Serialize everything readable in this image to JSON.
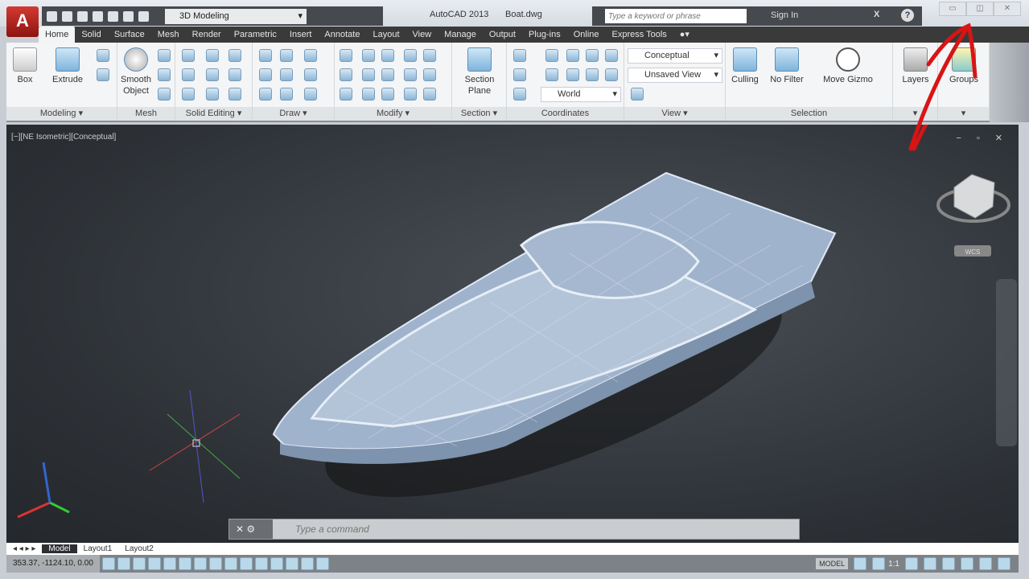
{
  "app": {
    "title": "AutoCAD 2013",
    "file": "Boat.dwg",
    "logo": "A"
  },
  "quick_access": {
    "workspace": "3D Modeling"
  },
  "search": {
    "placeholder": "Type a keyword or phrase",
    "sign_in": "Sign In"
  },
  "window_buttons": [
    "minimize-icon",
    "restore-icon",
    "close-icon"
  ],
  "tabs": [
    "Home",
    "Solid",
    "Surface",
    "Mesh",
    "Render",
    "Parametric",
    "Insert",
    "Annotate",
    "Layout",
    "View",
    "Manage",
    "Output",
    "Plug-ins",
    "Online",
    "Express Tools"
  ],
  "ribbon": {
    "panels": [
      "Modeling ▾",
      "Mesh",
      "Solid Editing ▾",
      "Draw ▾",
      "Modify ▾",
      "Section ▾",
      "Coordinates",
      "View ▾",
      "Selection",
      "▾",
      "▾"
    ],
    "buttons": {
      "box": "Box",
      "extrude": "Extrude",
      "smooth": "Smooth Object",
      "section": "Section Plane",
      "culling": "Culling",
      "nofilter": "No Filter",
      "gizmo": "Move Gizmo",
      "layers": "Layers",
      "groups": "Groups"
    },
    "combos": {
      "visual_style": "Conceptual",
      "view": "Unsaved View",
      "ucs": "World"
    }
  },
  "viewport": {
    "label": "[−][NE Isometric][Conceptual]",
    "controls": "− ▫ ✕",
    "wcs": "WCS"
  },
  "command": {
    "placeholder": "Type a command"
  },
  "layout_tabs": [
    "Model",
    "Layout1",
    "Layout2"
  ],
  "status": {
    "coords": "353.37, -1124.10, 0.00",
    "model": "MODEL",
    "scale": "1:1"
  },
  "colors": {
    "annotation": "#d81414",
    "accent": "#2d7fc1"
  }
}
